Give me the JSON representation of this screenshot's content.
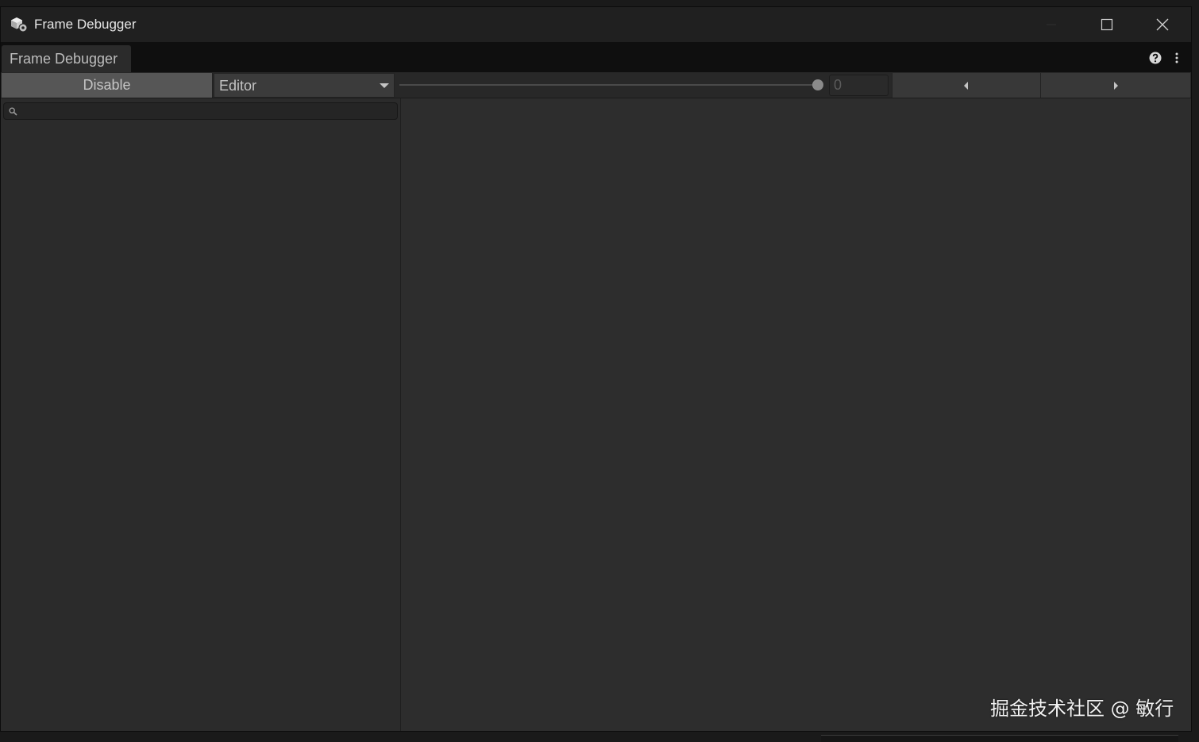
{
  "window": {
    "title": "Frame Debugger",
    "icons": {
      "app": "unity-cube-gear-icon",
      "minimize": "minimize-icon",
      "maximize": "maximize-icon",
      "close": "close-icon"
    }
  },
  "tabs": [
    {
      "label": "Frame Debugger",
      "active": true
    }
  ],
  "tab_actions": {
    "help_icon": "help-icon",
    "menu_icon": "more-menu-icon"
  },
  "toolbar": {
    "disable_label": "Disable",
    "target_dropdown": {
      "value": "Editor"
    },
    "event_slider": {
      "value": 1.0
    },
    "event_index": "0",
    "prev_icon": "triangle-left-icon",
    "next_icon": "triangle-right-icon"
  },
  "search": {
    "placeholder": "",
    "value": "",
    "icon": "search-icon"
  },
  "watermark": "掘金技术社区 @ 敏行",
  "colors": {
    "background": "#2b2b2b",
    "titlebar": "#202020",
    "tabstrip": "#0f0f0f",
    "button": "#565656",
    "text": "#c4c4c4"
  }
}
